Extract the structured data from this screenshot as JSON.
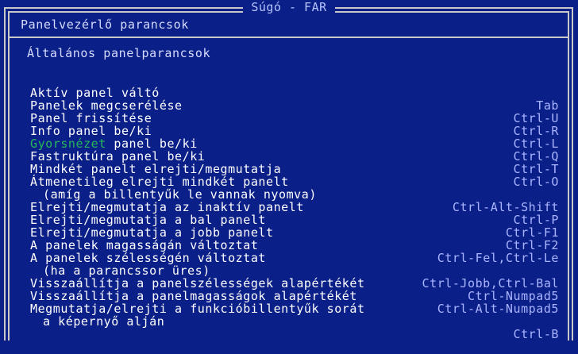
{
  "window": {
    "title": "Súgó - FAR"
  },
  "header": "Panelvezérlő parancsok",
  "section_title": "Általános panelparancsok",
  "rows": [
    {
      "label": "Aktív panel váltó",
      "key": "Tab"
    },
    {
      "label": "Panelek megcserélése",
      "key": "Ctrl-U"
    },
    {
      "label": "Panel frissítése",
      "key": "Ctrl-R"
    },
    {
      "label": "Info panel be/ki",
      "key": "Ctrl-L"
    },
    {
      "label_link": "Gyorsnézet",
      "label_rest": " panel be/ki",
      "key": "Ctrl-Q"
    },
    {
      "label": "Fastruktúra panel be/ki",
      "key": "Ctrl-T"
    },
    {
      "label": "Mindkét panelt elrejti/megmutatja",
      "key": "Ctrl-O"
    },
    {
      "label": "Átmenetileg elrejti mindkét panelt",
      "key": ""
    },
    {
      "label": "(amíg a billentyűk le vannak nyomva)",
      "key": "Ctrl-Alt-Shift",
      "indent": true
    },
    {
      "label": "Elrejti/megmutatja az inaktív panelt",
      "key": "Ctrl-P"
    },
    {
      "label": "Elrejti/megmutatja a bal panelt",
      "key": "Ctrl-F1"
    },
    {
      "label": "Elrejti/megmutatja a jobb panelt",
      "key": "Ctrl-F2"
    },
    {
      "label": "A panelek magasságán változtat",
      "key": "Ctrl-Fel,Ctrl-Le"
    },
    {
      "label": "A panelek szélességén változtat",
      "key": ""
    },
    {
      "label": "(ha a parancssor üres)",
      "key": "Ctrl-Jobb,Ctrl-Bal",
      "indent": true
    },
    {
      "label": "Visszaállítja a panelszélességek alapértékét",
      "key": "Ctrl-Numpad5"
    },
    {
      "label": "Visszaállítja a panelmagasságok alapértékét",
      "key": "Ctrl-Alt-Numpad5"
    },
    {
      "label": "Megmutatja/elrejti a funkcióbillentyűk sorát",
      "key": ""
    },
    {
      "label": "a képernyő alján",
      "key": "Ctrl-B",
      "indent": true
    }
  ]
}
